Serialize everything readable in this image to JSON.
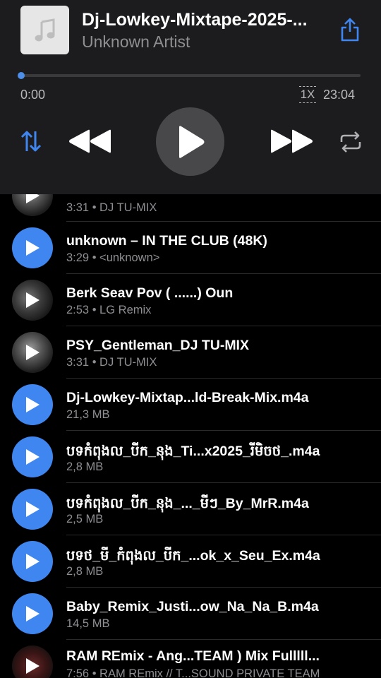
{
  "now_playing": {
    "title": "Dj-Lowkey-Mixtape-2025-...",
    "artist": "Unknown Artist",
    "elapsed": "0:00",
    "total": "23:04",
    "speed": "1X",
    "progress": 0.0
  },
  "icons": {
    "artwork": "music-note-icon",
    "share": "share-icon",
    "shuffle": "sort-arrows-icon",
    "rewind": "rewind-icon",
    "play": "play-icon",
    "forward": "fast-forward-icon",
    "repeat": "repeat-icon"
  },
  "colors": {
    "accent": "#3f86f0",
    "header_bg": "#1c1c1e",
    "list_bg": "#000000",
    "secondary_text": "#8e8e93"
  },
  "tracks": [
    {
      "title": "",
      "sub": "3:31 • DJ TU-MIX",
      "icon": "image"
    },
    {
      "title": "unknown – IN THE CLUB (48K)",
      "sub": "3:29 • <unknown>",
      "icon": "blue"
    },
    {
      "title": "Berk Seav Pov ( ......) Oun",
      "sub": "2:53 • LG Remix",
      "icon": "image"
    },
    {
      "title": "PSY_Gentleman_DJ TU-MIX",
      "sub": "3:31 • DJ TU-MIX",
      "icon": "image"
    },
    {
      "title": "Dj-Lowkey-Mixtap...ld-Break-Mix.m4a",
      "sub": "21,3 MB",
      "icon": "blue"
    },
    {
      "title": "បទកំពុងល_បីក_នុង_Ti...x2025_រីមិចថ_.m4a",
      "sub": "2,8 MB",
      "icon": "blue"
    },
    {
      "title": "បទកំពុងល_បីក_នុង_..._មីៗ_By_MrR.m4a",
      "sub": "2,5 MB",
      "icon": "blue"
    },
    {
      "title": "បទថ_មី_កំពុងល_បីក_...ok_x_Seu_Ex.m4a",
      "sub": "2,8 MB",
      "icon": "blue"
    },
    {
      "title": "Baby_Remix_Justi...ow_Na_Na_B.m4a",
      "sub": "14,5 MB",
      "icon": "blue"
    },
    {
      "title": "RAM REmix - Ang...TEAM ) Mix Fulllll...",
      "sub": "7:56 • RAM REmix // T...SOUND PRIVATE TEAM",
      "icon": "image"
    }
  ]
}
